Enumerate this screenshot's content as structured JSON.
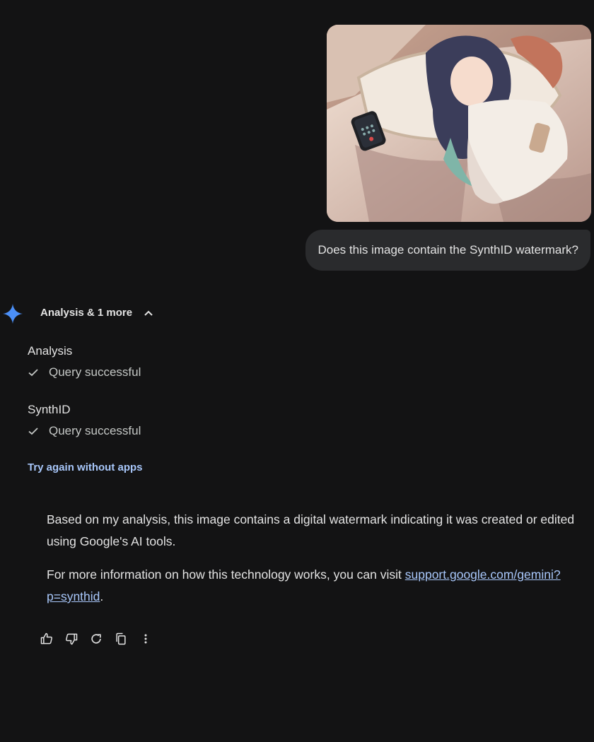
{
  "user_turn": {
    "image": {
      "description": "anime girl lying in bed with smartphone"
    },
    "message": "Does this image contain the SynthID watermark?"
  },
  "model_turn": {
    "tools_summary": "Analysis & 1 more",
    "tools": [
      {
        "name": "Analysis",
        "status": "Query successful"
      },
      {
        "name": "SynthID",
        "status": "Query successful"
      }
    ],
    "retry_link": "Try again without apps",
    "response": {
      "p1": "Based on my analysis, this image contains a digital watermark indicating it was created or edited using Google's AI tools.",
      "p2_prefix": "For more information on how this technology works, you can visit ",
      "p2_link": "support.google.com/gemini?p=synthid",
      "p2_suffix": "."
    },
    "actions": [
      "thumbs-up-icon",
      "thumbs-down-icon",
      "refresh-icon",
      "copy-icon",
      "more-vert-icon"
    ]
  },
  "colors": {
    "background": "#131314",
    "bubble": "#2a2b2d",
    "link": "#a8c7fa",
    "gemini_star": "#4b8ff7"
  }
}
